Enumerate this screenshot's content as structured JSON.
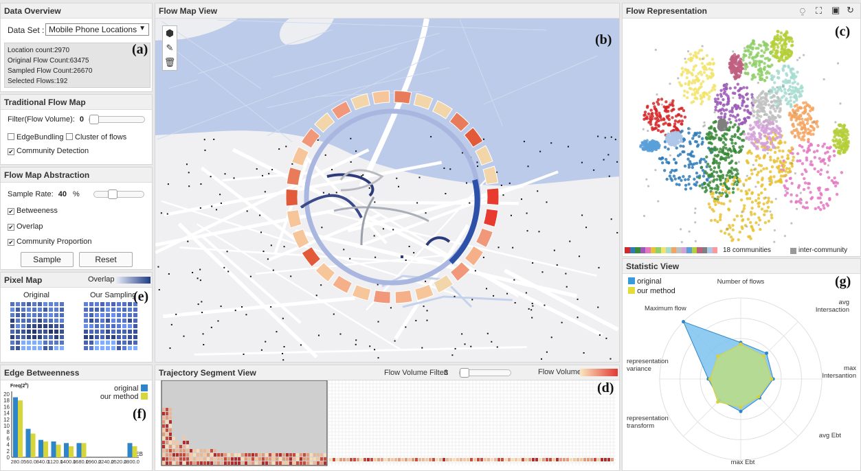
{
  "overview": {
    "title": "Data Overview",
    "dataset_label": "Data Set :",
    "dataset_value": "Mobile Phone Locations",
    "stats": [
      "Location count:2970",
      "Original Flow Count:63475",
      "Sampled Flow Count:26670",
      "Selected Flows:192"
    ],
    "tag": "(a)"
  },
  "traditional": {
    "title": "Traditional Flow Map",
    "filter_label": "Filter(Flow Volume):",
    "filter_value": "0",
    "filter_unit": "%",
    "opt_edge": "EdgeBundling",
    "opt_cluster": "Cluster of flows",
    "opt_community": "Community Detection"
  },
  "abstraction": {
    "title": "Flow Map Abstraction",
    "rate_label": "Sample Rate:",
    "rate_value": "40",
    "rate_unit": "%",
    "opt_between": "Betweeness",
    "opt_overlap": "Overlap",
    "opt_community": "Community Proportion",
    "sample_btn": "Sample",
    "reset_btn": "Reset"
  },
  "pixelmap": {
    "title": "Pixel Map",
    "legend": "Overlap",
    "original": "Original",
    "sampling": "Our Sampling",
    "tag": "(e)"
  },
  "edge": {
    "title": "Edge Betweenness",
    "ylabel": "Freq(2",
    "ysup": "k",
    "ylabel_end": ")",
    "xlabel": "EB",
    "legend_original": "original",
    "legend_ours": "our method",
    "tag": "(f)",
    "colors": {
      "original": "#2e86c8",
      "ours": "#d6d63a"
    }
  },
  "mapview": {
    "title": "Flow Map View",
    "tag": "(b)",
    "tools": [
      "lasso-icon",
      "edit-icon",
      "trash-icon"
    ]
  },
  "representation": {
    "title": "Flow Representation",
    "tag": "(c)",
    "legend_communities": "18 communities",
    "legend_inter": "inter-community"
  },
  "statistic": {
    "title": "Statistic View",
    "tag": "(g)",
    "legend_original": "original",
    "legend_ours": "our method",
    "axes": [
      "Number of flows",
      "avg Intersaction",
      "max Intersantion",
      "avg Ebt",
      "max Ebt",
      "representation transform",
      "representation variance",
      "Maximum flow"
    ]
  },
  "trajectory": {
    "title": "Trajectory Segment View",
    "filter_label": "Flow Volume Filter:",
    "filter_value": "3",
    "legend": "Flow Volume",
    "tag": "(d)"
  },
  "chart_data": [
    {
      "type": "bar",
      "title": "Edge Betweenness",
      "categories": [
        "280.0",
        "560.0",
        "840.0",
        "1120.0",
        "1400.0",
        "1680.0",
        "1960.0",
        "2240.0",
        "2520.0",
        "2800.0"
      ],
      "tick_labels": [
        "280.0",
        "560.0",
        "840.0",
        "1120.0",
        "1400.0",
        "1680.0",
        "1960.0",
        "2240.0",
        "2520.0",
        "2800.0"
      ],
      "series": [
        {
          "name": "original",
          "values": [
            19,
            9,
            5.5,
            5,
            4.5,
            4.5,
            0,
            0,
            0,
            4.5
          ]
        },
        {
          "name": "our method",
          "values": [
            18,
            7.5,
            5,
            4,
            3.5,
            4.5,
            0,
            0,
            0,
            3.5
          ]
        }
      ],
      "yticks": [
        0,
        2,
        4,
        6,
        8,
        10,
        12,
        14,
        16,
        18,
        20
      ],
      "ylim": [
        0,
        20
      ],
      "xlabel": "EB",
      "ylabel": "Freq(2^k)"
    },
    {
      "type": "radar",
      "title": "Statistic View",
      "axes": [
        "Number of flows",
        "avg Intersaction",
        "max Intersantion",
        "avg Ebt",
        "max Ebt",
        "representation transform",
        "representation variance",
        "Maximum flow"
      ],
      "series": [
        {
          "name": "original",
          "values": [
            0.45,
            0.45,
            0.4,
            0.33,
            0.4,
            0.37,
            0.4,
            1.0
          ]
        },
        {
          "name": "our method",
          "values": [
            0.43,
            0.4,
            0.38,
            0.31,
            0.35,
            0.4,
            0.38,
            0.4
          ]
        }
      ]
    }
  ],
  "community_colors": [
    "#d62728",
    "#2e7ab8",
    "#3a8a3a",
    "#9b59b6",
    "#e377c2",
    "#e8c234",
    "#8fcf6a",
    "#f2e36a",
    "#a6dcd0",
    "#f4a460",
    "#bfbfbf",
    "#d4a0d8",
    "#5aa0d8",
    "#b5cf3a",
    "#c06080",
    "#7f7f7f",
    "#aec7e8",
    "#ff9896"
  ]
}
